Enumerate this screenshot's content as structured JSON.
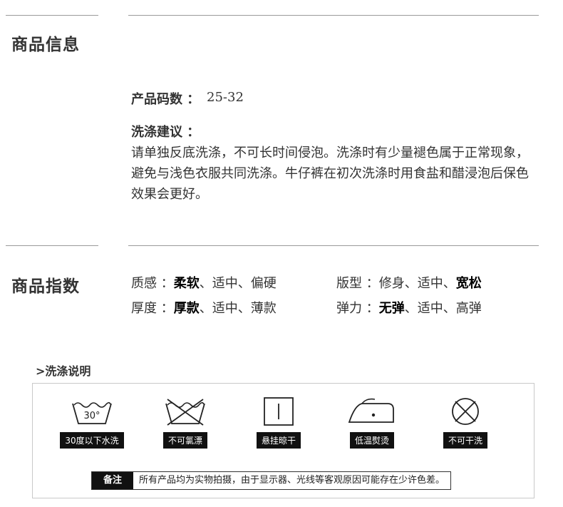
{
  "product_info": {
    "heading": "商品信息",
    "size_label": "产品码数 ：",
    "size_value": "25-32",
    "wash_label": "洗涤建议 ：",
    "wash_text": "请单独反底洗涤，不可长时间侵泡。洗涤时有少量褪色属于正常现象，避免与浅色衣服共同洗涤。牛仔裤在初次洗涤时用食盐和醋浸泡后保色效果会更好。"
  },
  "product_index": {
    "heading": "商品指数",
    "texture_label": "质感 ：",
    "texture_opts": [
      "柔软",
      "、适中",
      "、偏硬"
    ],
    "thickness_label": "厚度 ：",
    "thickness_opts": [
      "厚款",
      "、适中",
      "、薄款"
    ],
    "fit_label": "版型 ：",
    "fit_opts": [
      "修身",
      "、适中",
      "、",
      "宽松"
    ],
    "stretch_label": "弹力 ：",
    "stretch_opts": [
      "无弹",
      "、适中",
      "、高弹"
    ]
  },
  "care": {
    "title": ">洗涤说明",
    "items": [
      {
        "label": "30度以下水洗",
        "temp": "30°",
        "icon": "wash-30-icon"
      },
      {
        "label": "不可氯漂",
        "icon": "no-bleach-icon"
      },
      {
        "label": "悬挂晾干",
        "icon": "hang-dry-icon"
      },
      {
        "label": "低温熨烫",
        "icon": "iron-low-icon"
      },
      {
        "label": "不可干洗",
        "icon": "no-dry-clean-icon"
      }
    ],
    "note_tag": "备注",
    "note_text": "所有产品均为实物拍摄，由于显示器、光线等客观原因可能存在少许色差。"
  }
}
